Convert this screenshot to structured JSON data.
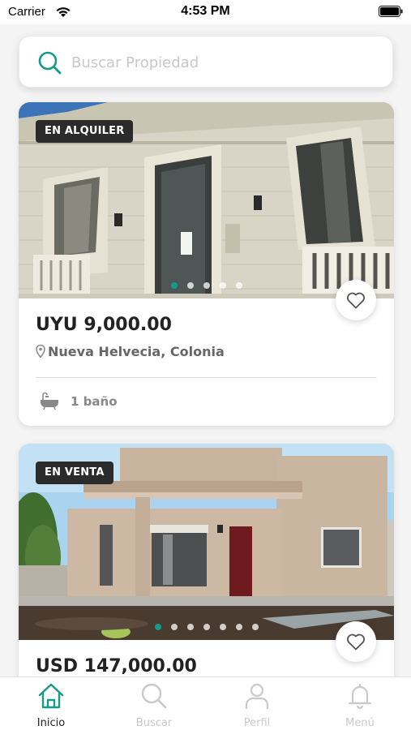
{
  "status_bar": {
    "carrier": "Carrier",
    "time": "4:53 PM"
  },
  "search": {
    "placeholder": "Buscar Propiedad",
    "value": ""
  },
  "listings": [
    {
      "badge": "EN ALQUILER",
      "price": "UYU 9,000.00",
      "location": "Nueva Helvecia, Colonia",
      "bathrooms": "1 baño",
      "photo_count": 5,
      "active_photo": 1
    },
    {
      "badge": "EN VENTA",
      "price": "USD 147,000.00",
      "photo_count": 7,
      "active_photo": 1
    }
  ],
  "tab_bar": {
    "items": [
      {
        "label": "Inicio",
        "icon": "home-icon",
        "active": true
      },
      {
        "label": "Buscar",
        "icon": "search-icon",
        "active": false
      },
      {
        "label": "Perfil",
        "icon": "user-icon",
        "active": false
      },
      {
        "label": "Menú",
        "icon": "bell-icon",
        "active": false
      }
    ]
  },
  "colors": {
    "accent": "#169a8c",
    "badge_bg": "#2b2b2b",
    "inactive_tab": "#c9c9c9"
  }
}
